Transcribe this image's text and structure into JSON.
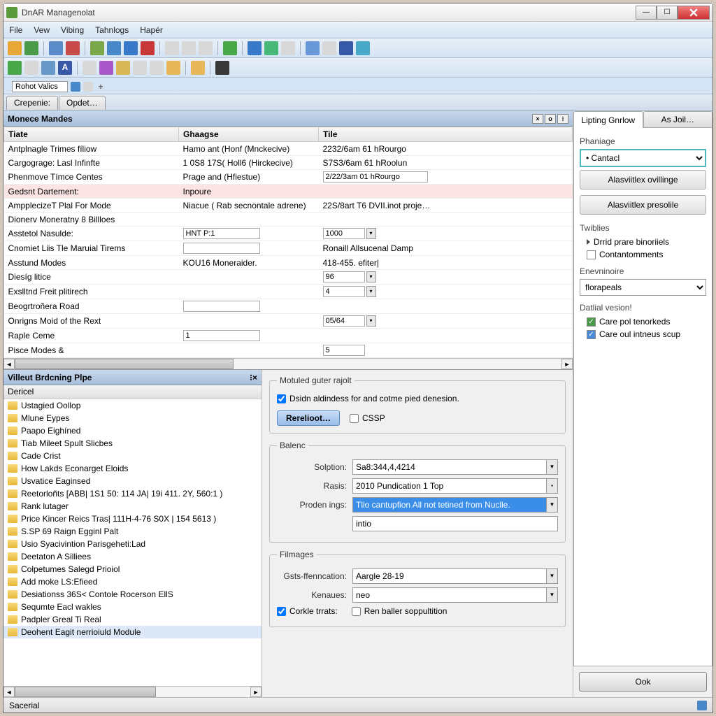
{
  "window": {
    "title": "DnAR Managenolat"
  },
  "menubar": [
    "File",
    "Vew",
    "Vibing",
    "Tahnlogs",
    "Hapér"
  ],
  "tabstrip": {
    "input_value": "Rohot Valics"
  },
  "subtabs": {
    "a": "Crepenie:",
    "b": "Opdet…"
  },
  "grid": {
    "title": "Monece Mandes",
    "columns": [
      "Tiate",
      "Ghaagse",
      "Tile"
    ],
    "rows": [
      {
        "c0": "Antplnagle Trimes fíliow",
        "c1": "Hamo ant (Honf (Mnckecive)",
        "c2": "2232/6am 61 hRourgo"
      },
      {
        "c0": "Cargograge: Lasl Infinfte",
        "c1": "1 0S8 17S( Holl6 (Hirckecive)",
        "c2": "S7S3/6am 61 hRoolun"
      },
      {
        "c0": "Phenmove Tímce Centes",
        "c1": "Prage and (Hfiestue)",
        "c2_special": "2/22/3am 01 hRourgo"
      },
      {
        "c0": "Gedsnt Dartement:",
        "c1": "Inpoure",
        "c2": "",
        "pink": true
      },
      {
        "c0": "AmpplecizeT Plal For Mode",
        "c1": "Niacue ( Rab secnontale adrene)",
        "c2": "22S/8art T6 DVII.inot proje…"
      },
      {
        "c0": "Dionerv Moneratny 8 Billloes",
        "c1": "",
        "c2": ""
      },
      {
        "c0": "Asstetol Nasulde:",
        "c1_input": "HNT P:1",
        "c2_stepper": "1000"
      },
      {
        "c0": "Cnomiet Liis Tle Maruial Tirems",
        "c1_input": "",
        "c2": "Ronaill Allsucenal Damp"
      },
      {
        "c0": "Asstund Modes",
        "c1": "KOU16 Moneraider.",
        "c2": "418-455. efiter|"
      },
      {
        "c0": "Diesíg litice",
        "c1": "",
        "c2_stepper": "96"
      },
      {
        "c0": "Exslltnd Freit plitirech",
        "c1": "",
        "c2_stepper": "4"
      },
      {
        "c0": "Beogrtroñera Road",
        "c1_input": "",
        "c2": ""
      },
      {
        "c0": "Onrigns Moid of the Rext",
        "c1": "",
        "c2_stepper": "05/64"
      },
      {
        "c0": "Raple Ceme",
        "c1_input": "1",
        "c2": ""
      },
      {
        "c0": "Pisce Modes &",
        "c1": "",
        "c2_input": "5"
      }
    ]
  },
  "tree": {
    "title": "Villeut Brdcning Plpe",
    "subtitle": "Dericel",
    "items": [
      "Ustagied Oollop",
      "Mlune Eypes",
      "Paapo Eighíned",
      "Tiab Mileet Spult Slicbes",
      "Cade Crist",
      "How Lakds Econarget Eloids",
      "Usvatice Eaginsed",
      "Reetorloñts [ABB| 1S1 50: 114 JA| 19i 411. 2Y, 560:1 )",
      "Rank lutager",
      "Price Kincer Reics Tras| 111H-4-76 S0X | 154 5613 )",
      "S.SP 69 Raign Egginl Palt",
      "Usio Syacivintion Parisgeheti:Lad",
      "Deetaton A Silliees",
      "Colpetumes Salegd Prioiol",
      "Add moke LS:Efieed",
      "Desiationss 36S< Contole Rocerson EllS",
      "Sequmte Eacl wakles",
      "Padpler Greal Ti Real",
      "Deohent Eagit nerrioiuld Module"
    ],
    "selected_index": 18
  },
  "form": {
    "group1": {
      "legend": "Motuled guter rajolt",
      "chk1_label": "Dsidn aldindess for and cotme pied denesion.",
      "btn": "Rerelioot…",
      "cssp": "CSSP"
    },
    "group2": {
      "legend": "Balenc",
      "solution_label": "Solption:",
      "solution": "Sa8:344,4,4214",
      "rasis_label": "Rasis:",
      "rasis": "2010 Pundication 1 Top",
      "proden_label": "Proden ings:",
      "proden": "Tlio cantupfion All not tetined from Nuclle.",
      "intio": "intio"
    },
    "group3": {
      "legend": "Filmages",
      "class_label": "Gsts-ffenncation:",
      "class_val": "Aargle 28-19",
      "kenaues_label": "Kenaues:",
      "kenaues_val": "neo",
      "chk_corkle": "Corkle trrats:",
      "chk_ren": "Ren baller soppultition"
    }
  },
  "right": {
    "tabs": {
      "a": "Lipting Gnrlow",
      "b": "As Joil…"
    },
    "phaniage": "Phaniage",
    "cantacl": "Cantacl",
    "btn1": "Alasviitlex ovillinge",
    "btn2": "Alasviitlex presolile",
    "twibles": "Twiblies",
    "twibles_items": [
      "Drrid prare binoriiels",
      "Contantomments"
    ],
    "enenvinoire": "Enevninoire",
    "enenv_val": "florapeals",
    "datlial": "Datlial vesion!",
    "dat_items": [
      "Care pol tenorkeds",
      "Care oul intneus scup"
    ],
    "ok": "Ook"
  },
  "status": {
    "left": "Sacerial"
  }
}
